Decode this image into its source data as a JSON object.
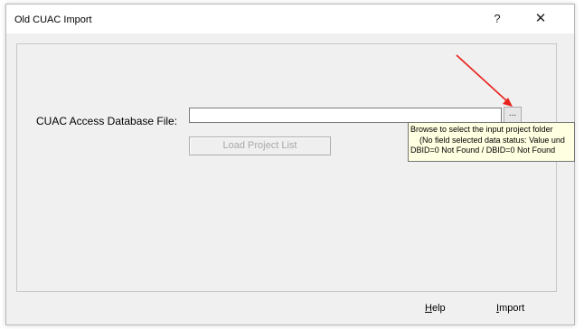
{
  "window": {
    "title": "Old CUAC Import",
    "help_glyph": "?",
    "close_glyph": "✕"
  },
  "form": {
    "file_label": "CUAC Access Database File:",
    "file_value": "",
    "browse_label": "...",
    "load_button_label": "Load Project List",
    "load_button_enabled": false
  },
  "tooltip": {
    "line1": "Browse to select the input project folder",
    "line2": "(No field selected data status: Value und",
    "line3": "DBID=0 Not Found / DBID=0 Not Found"
  },
  "footer": {
    "help_first": "H",
    "help_rest": "elp",
    "import_first": "I",
    "import_rest": "mport"
  },
  "annotation": {
    "arrow_color": "#e8231b"
  }
}
